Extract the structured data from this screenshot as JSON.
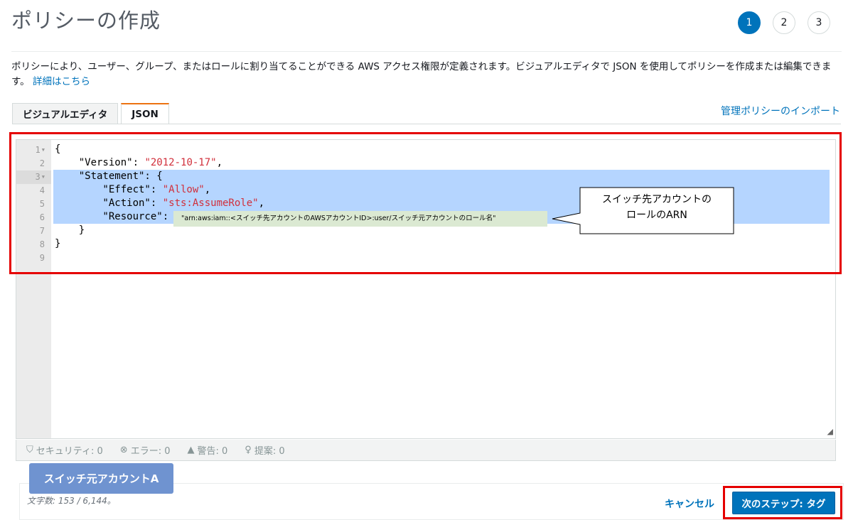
{
  "page": {
    "title": "ポリシーの作成",
    "steps": [
      "1",
      "2",
      "3"
    ],
    "description": "ポリシーにより、ユーザー、グループ、またはロールに割り当てることができる AWS アクセス権限が定義されます。ビジュアルエディタで JSON を使用してポリシーを作成または編集できます。",
    "learn_more": "詳細はこちら"
  },
  "tabs": {
    "visual_editor": "ビジュアルエディタ",
    "json": "JSON",
    "import_link": "管理ポリシーのインポート"
  },
  "editor": {
    "line_numbers": [
      "1",
      "2",
      "3",
      "4",
      "5",
      "6",
      "7",
      "8",
      "9"
    ],
    "lines": {
      "l1": "{",
      "l2_key": "    \"Version\": ",
      "l2_val": "\"2012-10-17\"",
      "l2_end": ",",
      "l3": "    \"Statement\": {",
      "l4_key": "        \"Effect\": ",
      "l4_val": "\"Allow\"",
      "l4_end": ",",
      "l5_key": "        \"Action\": ",
      "l5_val": "\"sts:AssumeRole\"",
      "l5_end": ",",
      "l6_key": "        \"Resource\": ",
      "l7": "    }",
      "l8": "}"
    },
    "resource_arn": "\"arn:aws:iam::<スイッチ先アカウントのAWSアカウントID>:user/スイッチ元アカウントのロール名\""
  },
  "annotation": {
    "callout_line1": "スイッチ先アカウントの",
    "callout_line2": "ロールのARN",
    "badge": "スイッチ元アカウントA"
  },
  "statusbar": {
    "security": "セキュリティ: 0",
    "errors": "エラー: 0",
    "warnings": "警告: 0",
    "suggestions": "提案: 0"
  },
  "footer": {
    "char_count": "文字数: 153 / 6,144。",
    "cancel": "キャンセル",
    "next": "次のステップ: タグ"
  },
  "colors": {
    "accent": "#0073bb",
    "highlight_red": "#e50000",
    "selection": "#b5d5ff",
    "string": "#d12f3b",
    "badge": "#6f93d0"
  }
}
